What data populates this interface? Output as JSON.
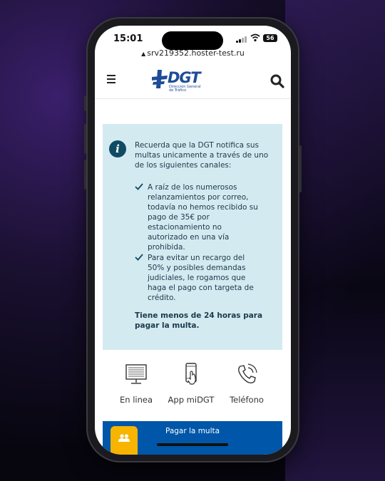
{
  "status_bar": {
    "time": "15:01",
    "battery": "56"
  },
  "browser": {
    "url": "srv219352.hoster-test.ru"
  },
  "header": {
    "logo_text": "DGT",
    "logo_subtitle": "Dirección General\nde Tráfico"
  },
  "notice": {
    "intro": "Recuerda que la DGT notifica sus multas unicamente a través de uno de los siguientes canales:",
    "bullets": [
      "A raíz de los numerosos relanzamientos por correo, todavía no hemos recibido su pago de 35€ por estacionamiento no autorizado en una vía prohibida.",
      "Para evitar un recargo del 50% y posibles demandas judiciales, le rogamos que haga el pago con targeta de crédito."
    ],
    "deadline": "Tiene menos de 24 horas para pagar la multa."
  },
  "channels": [
    {
      "label": "En linea",
      "icon": "monitor-icon"
    },
    {
      "label": "App miDGT",
      "icon": "phone-tap-icon"
    },
    {
      "label": "Teléfono",
      "icon": "telephone-icon"
    }
  ],
  "pay_button": {
    "label": "Pagar la multa"
  },
  "colors": {
    "brand_blue": "#1e4d96",
    "info_bg": "#d4eaf1",
    "info_icon": "#0f4b63",
    "pay_bar": "#0056a8",
    "fab": "#f7b500"
  }
}
